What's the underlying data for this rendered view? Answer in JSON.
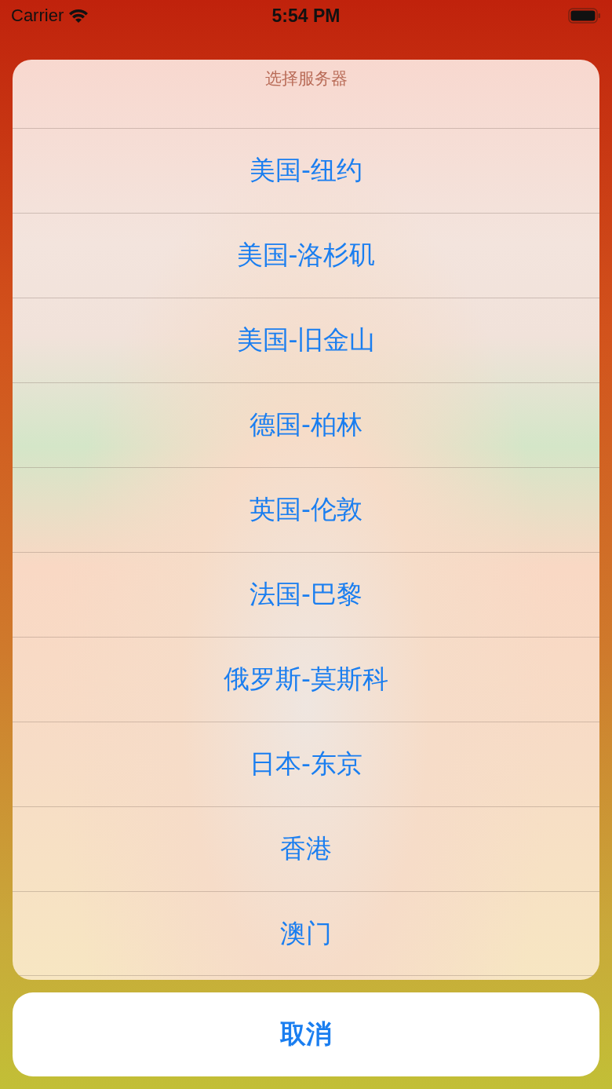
{
  "status_bar": {
    "carrier": "Carrier",
    "time": "5:54 PM"
  },
  "action_sheet": {
    "title": "选择服务器",
    "options": [
      {
        "label": "美国-纽约"
      },
      {
        "label": "美国-洛杉矶"
      },
      {
        "label": "美国-旧金山"
      },
      {
        "label": "德国-柏林"
      },
      {
        "label": "英国-伦敦"
      },
      {
        "label": "法国-巴黎"
      },
      {
        "label": "俄罗斯-莫斯科"
      },
      {
        "label": "日本-东京"
      },
      {
        "label": "香港"
      },
      {
        "label": "澳门"
      }
    ],
    "cancel": "取消"
  }
}
